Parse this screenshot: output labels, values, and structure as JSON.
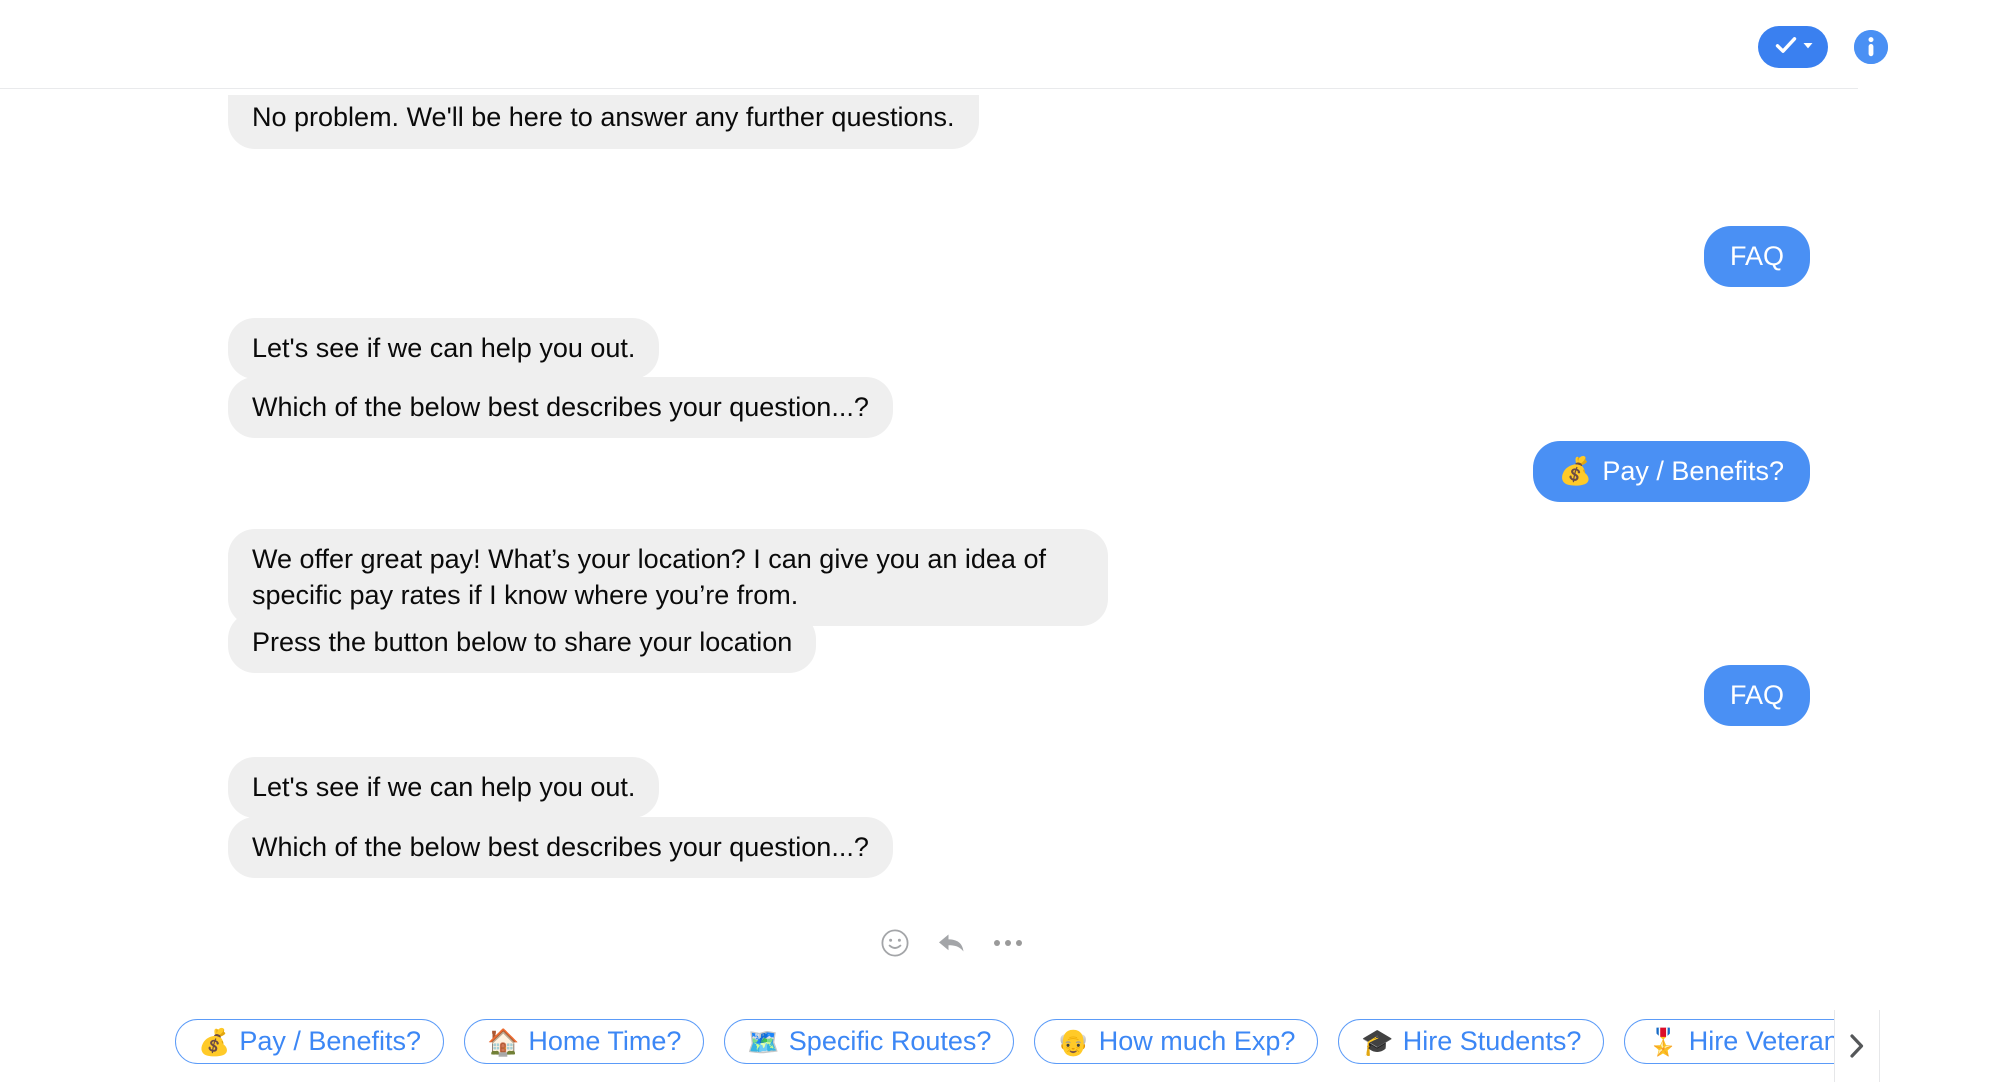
{
  "header": {
    "mark_done_label": "",
    "icons": {
      "done_check": "check-icon",
      "done_caret": "caret-down-icon",
      "info": "info-icon"
    }
  },
  "thread": {
    "messages": [
      {
        "id": "m0",
        "side": "incoming",
        "text": "No problem. We'll be here to answer any further questions.",
        "clipped_top": true
      },
      {
        "id": "m1",
        "side": "outgoing",
        "text": "FAQ"
      },
      {
        "id": "m2",
        "side": "incoming",
        "text": "Let's see if we can help you out."
      },
      {
        "id": "m3",
        "side": "incoming",
        "text": "Which of the below best describes your question...?"
      },
      {
        "id": "m4",
        "side": "outgoing",
        "emoji": "💰",
        "text": "Pay / Benefits?"
      },
      {
        "id": "m5",
        "side": "incoming",
        "text": "We offer great pay! What’s your location? I can give you an idea of specific pay rates if I know where you’re from."
      },
      {
        "id": "m6",
        "side": "incoming",
        "text": "Press the button below to share your location"
      },
      {
        "id": "m7",
        "side": "outgoing",
        "text": "FAQ"
      },
      {
        "id": "m8",
        "side": "incoming",
        "text": "Let's see if we can help you out."
      },
      {
        "id": "m9",
        "side": "incoming",
        "text": "Which of the below best describes your question...?"
      }
    ]
  },
  "message_actions": {
    "react_icon": "smiley-face-icon",
    "reply_icon": "reply-arrow-icon",
    "more_icon": "ellipsis-icon"
  },
  "quick_replies": {
    "scroll_next_icon": "chevron-right-icon",
    "chips": [
      {
        "emoji": "💰",
        "label": "Pay / Benefits?"
      },
      {
        "emoji": "🏠",
        "label": "Home Time?"
      },
      {
        "emoji": "🗺️",
        "label": "Specific Routes?"
      },
      {
        "emoji": "👴",
        "label": "How much Exp?"
      },
      {
        "emoji": "🎓",
        "label": "Hire Students?"
      },
      {
        "emoji": "🎖️",
        "label": "Hire Veterans?"
      }
    ]
  },
  "colors": {
    "outgoing_bubble": "#4a90f4",
    "incoming_bubble": "#efefef",
    "chip_border": "#5b9bf8",
    "chip_text": "#3c87f5",
    "accent": "#3a80f0"
  }
}
